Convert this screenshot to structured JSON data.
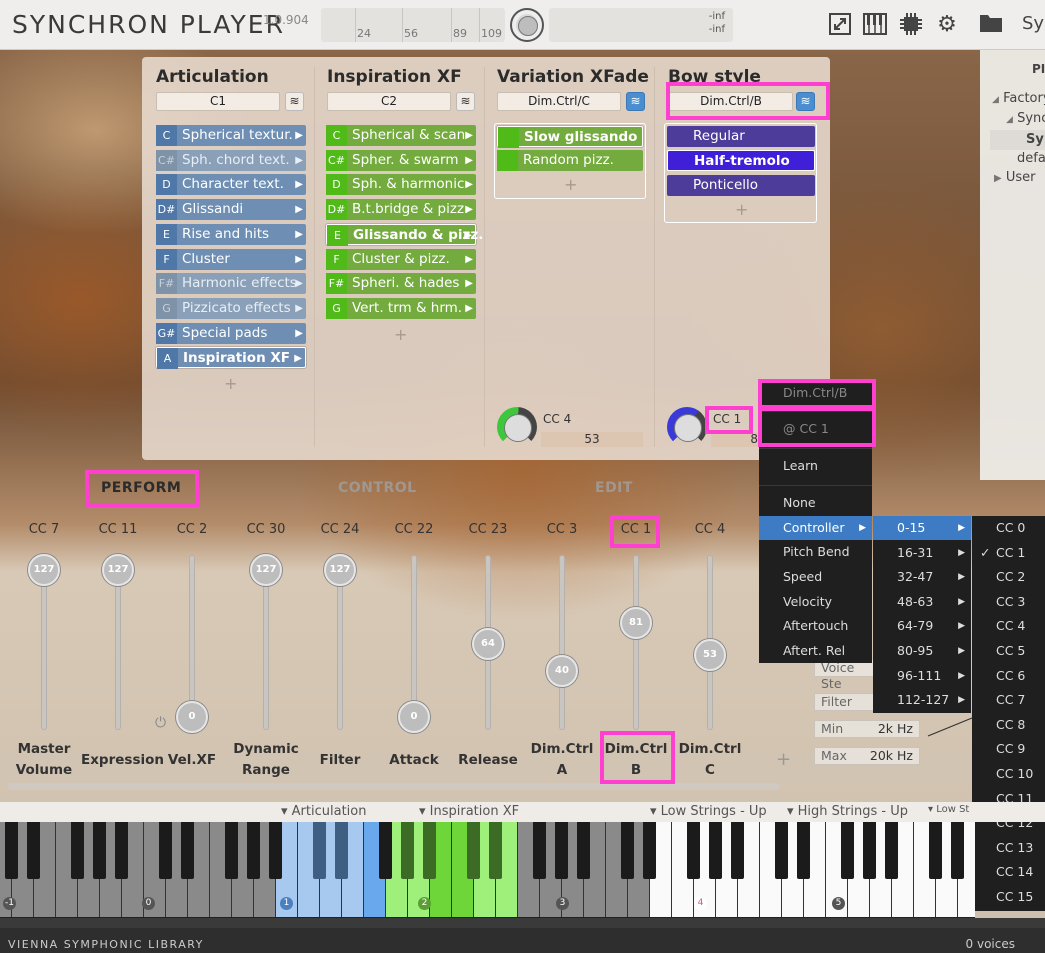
{
  "header": {
    "title": "SYNCHRON PLAYER",
    "version": "1.0.904",
    "meter_ticks": [
      "24",
      "56",
      "89",
      "109"
    ],
    "peak_left": "-inf",
    "peak_right": "-inf",
    "right_cut": "Sy"
  },
  "browser": {
    "header_cut": "PI",
    "items": [
      "Factory",
      "Sync",
      "Syn",
      "defau",
      "User"
    ]
  },
  "articulation": {
    "title": "Articulation",
    "selector": "C1",
    "items": [
      {
        "key": "C",
        "label": "Spherical textur.",
        "state": "normal"
      },
      {
        "key": "C#",
        "label": "Sph. chord text.",
        "state": "dim"
      },
      {
        "key": "D",
        "label": "Character text.",
        "state": "normal"
      },
      {
        "key": "D#",
        "label": "Glissandi",
        "state": "normal"
      },
      {
        "key": "E",
        "label": "Rise and hits",
        "state": "normal"
      },
      {
        "key": "F",
        "label": "Cluster",
        "state": "normal"
      },
      {
        "key": "F#",
        "label": "Harmonic effects",
        "state": "dim"
      },
      {
        "key": "G",
        "label": "Pizzicato effects",
        "state": "dim"
      },
      {
        "key": "G#",
        "label": "Special pads",
        "state": "normal"
      },
      {
        "key": "A",
        "label": "Inspiration XF",
        "state": "selected"
      }
    ],
    "add": "+"
  },
  "inspiration": {
    "title": "Inspiration XF",
    "selector": "C2",
    "items": [
      {
        "key": "C",
        "label": "Spherical & scan",
        "state": "normal"
      },
      {
        "key": "C#",
        "label": "Spher. & swarm",
        "state": "normal"
      },
      {
        "key": "D",
        "label": "Sph. & harmonic",
        "state": "normal"
      },
      {
        "key": "D#",
        "label": "B.t.bridge & pizz.",
        "state": "normal"
      },
      {
        "key": "E",
        "label": "Glissando & pizz.",
        "state": "selected"
      },
      {
        "key": "F",
        "label": "Cluster & pizz.",
        "state": "normal"
      },
      {
        "key": "F#",
        "label": "Spheri. & hades",
        "state": "normal"
      },
      {
        "key": "G",
        "label": "Vert. trm & hrm.",
        "state": "normal"
      }
    ],
    "add": "+"
  },
  "variation": {
    "title": "Variation XFade",
    "selector": "Dim.Ctrl/C",
    "items": [
      "Slow glissando",
      "Random pizz."
    ],
    "add": "+",
    "cc_label": "CC 4",
    "cc_value": "53"
  },
  "bowstyle": {
    "title": "Bow style",
    "selector": "Dim.Ctrl/B",
    "items": [
      "Regular",
      "Half-tremolo",
      "Ponticello"
    ],
    "add": "+",
    "cc_label": "CC 1",
    "cc_value_cut": "8"
  },
  "tabs": [
    "PERFORM",
    "CONTROL",
    "EDIT"
  ],
  "faders": [
    {
      "cc": "CC 7",
      "value": "127",
      "level": 1.0,
      "label": [
        "Master",
        "Volume"
      ]
    },
    {
      "cc": "CC 11",
      "value": "127",
      "level": 1.0,
      "label": [
        "Expression"
      ]
    },
    {
      "cc": "CC 2",
      "value": "0",
      "level": 0.0,
      "label": [
        "Vel.XF"
      ]
    },
    {
      "cc": "CC 30",
      "value": "127",
      "level": 1.0,
      "label": [
        "Dynamic",
        "Range"
      ]
    },
    {
      "cc": "CC 24",
      "value": "127",
      "level": 1.0,
      "label": [
        "Filter"
      ]
    },
    {
      "cc": "CC 22",
      "value": "0",
      "level": 0.0,
      "label": [
        "Attack"
      ]
    },
    {
      "cc": "CC 23",
      "value": "64",
      "level": 0.5,
      "label": [
        "Release"
      ]
    },
    {
      "cc": "CC 3",
      "value": "40",
      "level": 0.31,
      "label": [
        "Dim.Ctrl",
        "A"
      ]
    },
    {
      "cc": "CC 1",
      "value": "81",
      "level": 0.64,
      "label": [
        "Dim.Ctrl",
        "B"
      ]
    },
    {
      "cc": "CC 4",
      "value": "53",
      "level": 0.42,
      "label": [
        "Dim.Ctrl",
        "C"
      ]
    }
  ],
  "fader_add": "+",
  "context_menu": {
    "header": "Dim.Ctrl/B",
    "current": "@ CC 1",
    "items": [
      "Learn",
      "None",
      "Controller",
      "Pitch Bend",
      "Speed",
      "Velocity",
      "Aftertouch",
      "Aftert. Rel"
    ],
    "highlighted": "Controller"
  },
  "range_menu": {
    "items": [
      "0-15",
      "16-31",
      "32-47",
      "48-63",
      "64-79",
      "80-95",
      "96-111",
      "112-127"
    ],
    "highlighted": "0-15"
  },
  "cc_menu": {
    "items": [
      "CC 0",
      "CC 1",
      "CC 2",
      "CC 3",
      "CC 4",
      "CC 5",
      "CC 6",
      "CC 7",
      "CC 8",
      "CC 9",
      "CC 10",
      "CC 11",
      "CC 12",
      "CC 13",
      "CC 14",
      "CC 15"
    ],
    "checked": "CC 1",
    "check_mark": "✓"
  },
  "filter_panel": {
    "voice_cut": "Voice Ste",
    "filter": "Filter",
    "min_label": "Min",
    "min_value": "2k Hz",
    "max_label": "Max",
    "max_value": "20k Hz"
  },
  "keyboard": {
    "zones": [
      "▾ Articulation",
      "▾ Inspiration XF",
      "▾ Low Strings - Up",
      "▾ High Strings - Up",
      "▾ Low St"
    ],
    "octaves": [
      "-1",
      "0",
      "1",
      "2",
      "3",
      "4",
      "5"
    ]
  },
  "footer": {
    "brand": "VIENNA SYMPHONIC LIBRARY",
    "voices": "0 voices"
  },
  "colors": {
    "highlight": "#ff3fd0",
    "articulation_blue": "#6e8fb3",
    "inspiration_green": "#74ab3e",
    "bow_violet": "#4e3c9a",
    "menu_highlight": "#3d7cc4"
  }
}
